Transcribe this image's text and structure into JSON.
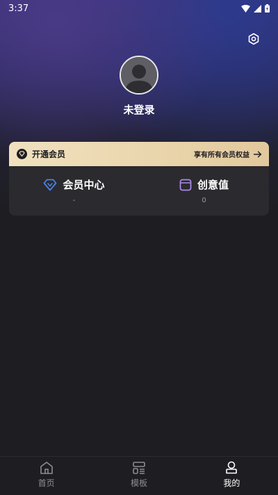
{
  "status_bar": {
    "time": "3:37"
  },
  "profile": {
    "username": "未登录"
  },
  "vip_banner": {
    "title": "开通会员",
    "subtitle": "享有所有会员权益"
  },
  "stats": [
    {
      "label": "会员中心",
      "value": "-",
      "icon": "diamond-icon"
    },
    {
      "label": "创意值",
      "value": "0",
      "icon": "wallet-icon"
    }
  ],
  "tabbar": {
    "items": [
      {
        "label": "首页",
        "icon": "home-icon",
        "active": false
      },
      {
        "label": "模板",
        "icon": "template-icon",
        "active": false
      },
      {
        "label": "我的",
        "icon": "profile-icon",
        "active": true
      }
    ]
  },
  "colors": {
    "background": "#1e1e22",
    "card": "#2a2a2f",
    "vip_gold": "#ead6ad",
    "diamond_blue": "#4a82e8",
    "wallet_purple": "#a98ae8"
  }
}
